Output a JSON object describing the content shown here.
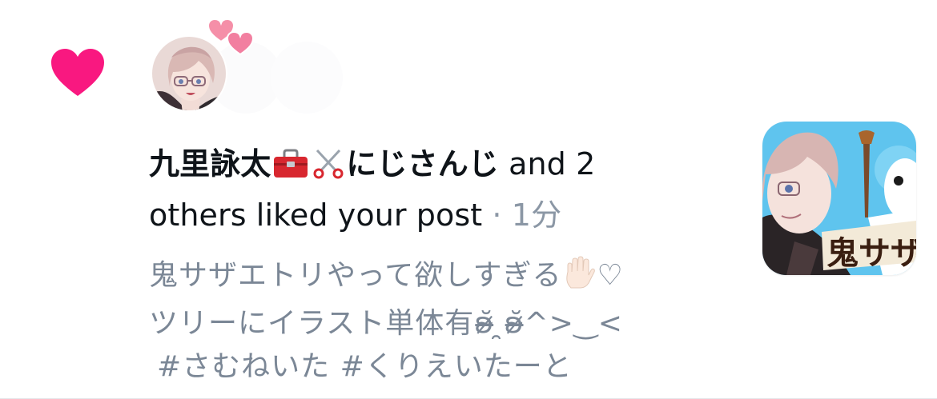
{
  "notification": {
    "type_icon": "heart-icon",
    "accent_color": "#f91880",
    "avatar": {
      "icon": "anime-avatar"
    },
    "decoration_icon": "floating-hearts-icon",
    "headline": {
      "name": "九里詠太",
      "name_suffix": "にじさんじ",
      "name_emojis": [
        "toolbox-emoji",
        "scissors-emoji"
      ],
      "action": " and 2 others liked your post",
      "separator": " · ",
      "time": "1分"
    },
    "post": {
      "line1": "鬼サザエトリやって欲しすぎる",
      "line1_emojis": [
        "raised-hand-emoji",
        "white-heart-emoji"
      ],
      "line1_heart": "♡",
      "line2": "ツリーにイラスト単体有ʚ̴̶̷̆ ̯ʚ̴̶̷̆^>‿<",
      "line3": " #さむねいた #くりえいたーと"
    },
    "thumbnail": {
      "icon": "post-image-thumbnail",
      "caption": "鬼サザ"
    }
  }
}
